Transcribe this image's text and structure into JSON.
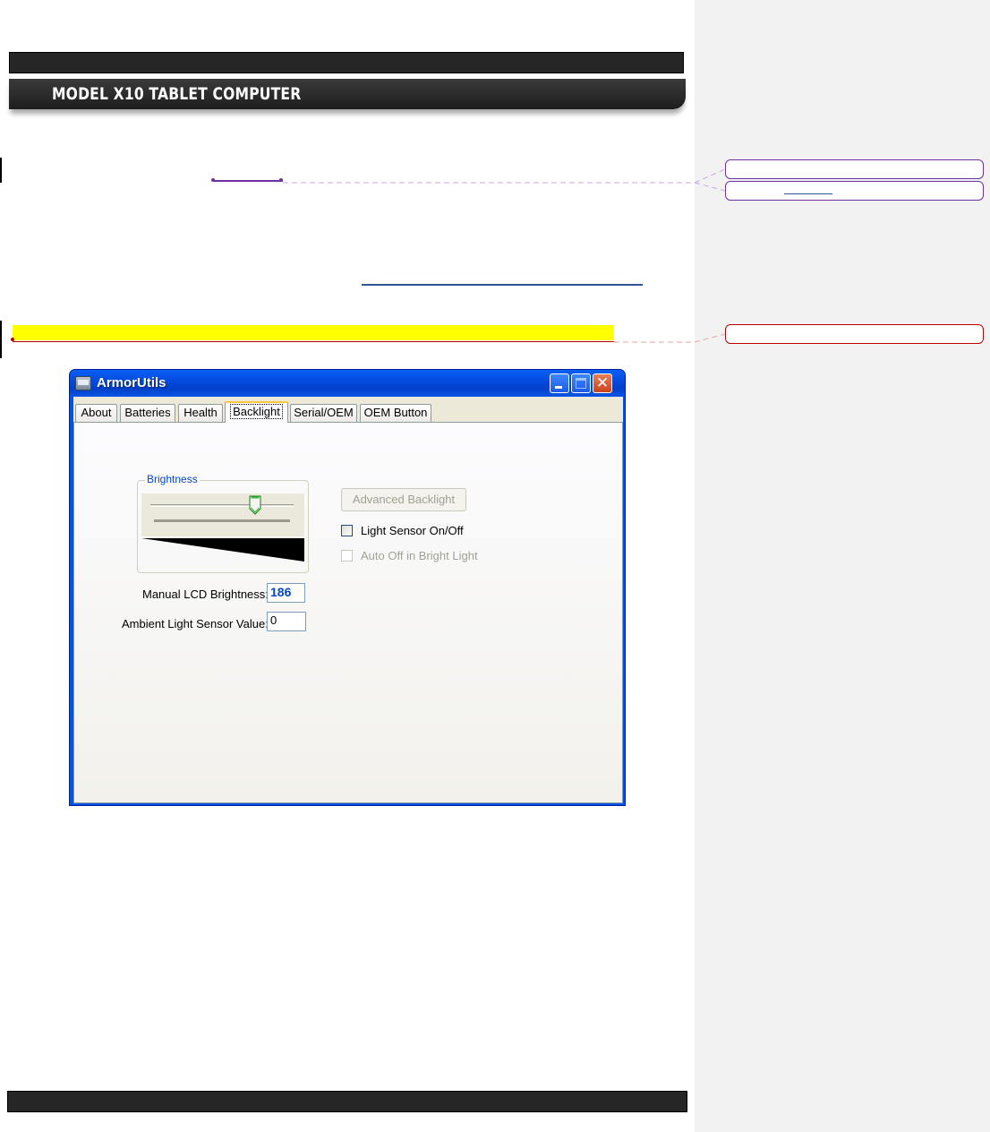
{
  "header": {
    "title": "MODEL X10 TABLET COMPUTER"
  },
  "window": {
    "title": "ArmorUtils",
    "tabs": [
      {
        "label": "About"
      },
      {
        "label": "Batteries"
      },
      {
        "label": "Health"
      },
      {
        "label": "Backlight",
        "active": true
      },
      {
        "label": "Serial/OEM"
      },
      {
        "label": "OEM Button"
      }
    ]
  },
  "backlight": {
    "group_label": "Brightness",
    "slider_level_fraction": 0.73,
    "manual_label": "Manual LCD Brightness:",
    "manual_value": "186",
    "ambient_label": "Ambient Light Sensor Value:",
    "ambient_value": "0",
    "advanced_button": "Advanced Backlight",
    "light_sensor_label": "Light Sensor On/Off",
    "light_sensor_checked": false,
    "auto_off_label": "Auto Off in Bright Light",
    "auto_off_checked": false
  },
  "colors": {
    "comment_purple": "#7030a0",
    "comment_red": "#c00000",
    "highlight": "#ffff00",
    "xp_title_blue": "#0054e3",
    "value_blue": "#0046d5"
  },
  "icons": {
    "app": "app-window-icon",
    "minimize": "minimize-icon",
    "maximize": "maximize-icon",
    "close": "close-icon"
  }
}
